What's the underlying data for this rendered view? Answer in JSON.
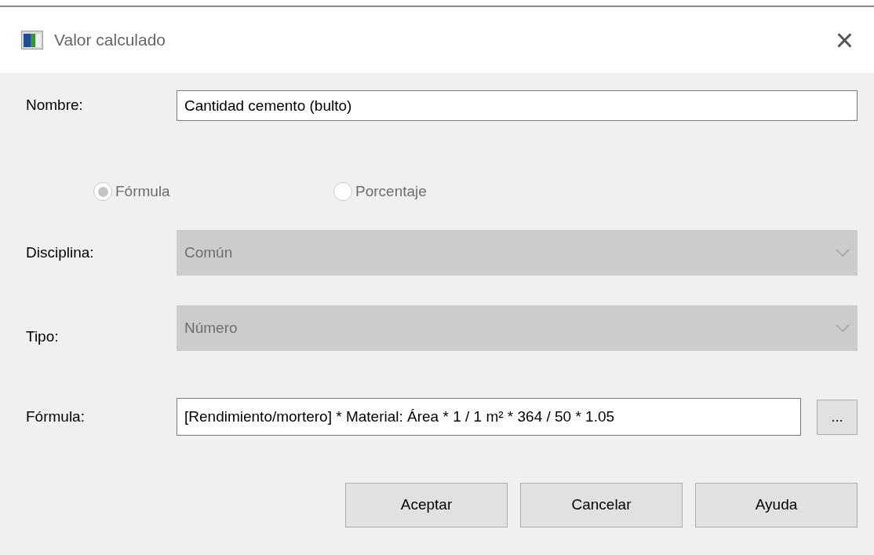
{
  "window": {
    "title": "Valor calculado",
    "close": "×"
  },
  "name_field": {
    "label": "Nombre:",
    "value": "Cantidad cemento (bulto)"
  },
  "mode_options": [
    {
      "label": "Fórmula",
      "selected": true,
      "disabled": true
    },
    {
      "label": "Porcentaje",
      "selected": false,
      "disabled": true
    }
  ],
  "selects": [
    {
      "label": "Disciplina:",
      "value": "Común",
      "disabled": true
    },
    {
      "label": "Tipo:",
      "value": "Número",
      "disabled": true
    }
  ],
  "formula_field": {
    "label": "Fórmula:",
    "value": "[Rendimiento/mortero] * Material: Área * 1 / 1 m² * 364 / 50 * 1.05",
    "browse": "..."
  },
  "buttons": [
    "Aceptar",
    "Cancelar",
    "Ayuda"
  ]
}
